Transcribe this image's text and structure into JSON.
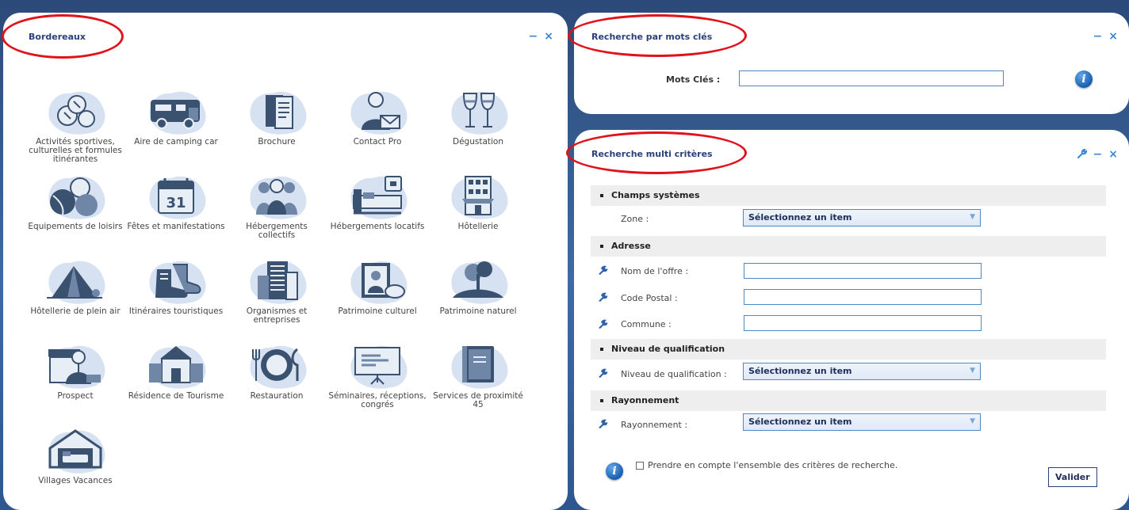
{
  "bordereaux": {
    "title": "Bordereaux",
    "minimize": "−",
    "close": "×",
    "items": [
      {
        "label": "Activités sportives, culturelles et formules itinérantes",
        "icon": "sports-balls-icon"
      },
      {
        "label": "Aire de camping car",
        "icon": "camping-car-icon"
      },
      {
        "label": "Brochure",
        "icon": "brochure-icon"
      },
      {
        "label": "Contact Pro",
        "icon": "contact-pro-icon"
      },
      {
        "label": "Dégustation",
        "icon": "wine-glasses-icon"
      },
      {
        "label": "Equipements de loisirs",
        "icon": "leisure-balls-icon"
      },
      {
        "label": "Fêtes et manifestations",
        "icon": "calendar-icon"
      },
      {
        "label": "Hébergements collectifs",
        "icon": "group-people-icon"
      },
      {
        "label": "Hébergements locatifs",
        "icon": "bed-icon"
      },
      {
        "label": "Hôtellerie",
        "icon": "hotel-building-icon"
      },
      {
        "label": "Hôtellerie de plein air",
        "icon": "tent-icon"
      },
      {
        "label": "Itinéraires touristiques",
        "icon": "hiking-boots-icon"
      },
      {
        "label": "Organismes et entreprises",
        "icon": "office-building-icon"
      },
      {
        "label": "Patrimoine culturel",
        "icon": "painting-icon"
      },
      {
        "label": "Patrimoine naturel",
        "icon": "tree-icon"
      },
      {
        "label": "Prospect",
        "icon": "shop-person-icon"
      },
      {
        "label": "Résidence de Tourisme",
        "icon": "residence-icon"
      },
      {
        "label": "Restauration",
        "icon": "plate-cutlery-icon"
      },
      {
        "label": "Séminaires, réceptions, congrés",
        "icon": "presentation-board-icon"
      },
      {
        "label": "Services de proximité 45",
        "icon": "book-icon"
      },
      {
        "label": "Villages Vacances",
        "icon": "garage-house-icon"
      }
    ]
  },
  "keywords": {
    "title": "Recherche par mots clés",
    "minimize": "−",
    "close": "×",
    "label": "Mots Clés :",
    "value": "",
    "info": "i"
  },
  "multi": {
    "title": "Recherche multi critères",
    "wrench": "✎",
    "minimize": "−",
    "close": "×",
    "sections": {
      "systemes": "Champs systèmes",
      "adresse": "Adresse",
      "niveau": "Niveau de qualification",
      "rayonnement": "Rayonnement"
    },
    "fields": {
      "zone_label": "Zone :",
      "zone_value": "Sélectionnez un item",
      "nom_label": "Nom de l'offre :",
      "cp_label": "Code Postal :",
      "commune_label": "Commune :",
      "niveau_label": "Niveau de qualification :",
      "niveau_value": "Sélectionnez un item",
      "rayon_label": "Rayonnement :",
      "rayon_value": "Sélectionnez un item"
    },
    "checkbox_label": "Prendre en compte l'ensemble des critères de recherche.",
    "info": "i",
    "submit": "Valider"
  },
  "colors": {
    "accent": "#3a86d0",
    "title": "#2b3f7a",
    "annotation": "#e0121b",
    "icon_blob": "#d6e2f1",
    "icon_dark": "#3b5170"
  }
}
